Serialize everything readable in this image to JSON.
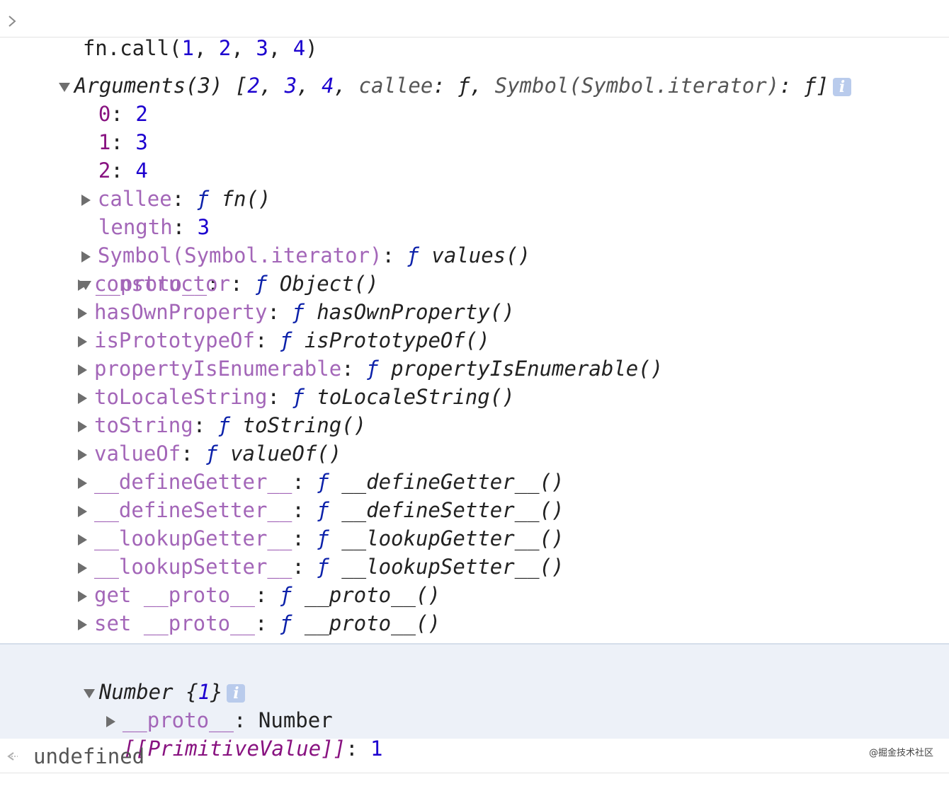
{
  "command": {
    "text": "fn.call(",
    "args": [
      "1",
      "2",
      "3",
      "4"
    ],
    "close": ")"
  },
  "args_summary": {
    "label": "Arguments(3)",
    "open": " [",
    "v1": "2",
    "v2": "3",
    "v3": "4",
    "callee_key": "callee",
    "colon_f": ": ƒ, ",
    "symbol_key": "Symbol(Symbol.iterator)",
    "end": ": ƒ]"
  },
  "indices": [
    {
      "key": "0",
      "value": "2"
    },
    {
      "key": "1",
      "value": "3"
    },
    {
      "key": "2",
      "value": "4"
    }
  ],
  "callee": {
    "key": "callee",
    "f": "ƒ",
    "value": "fn()"
  },
  "length": {
    "key": "length",
    "value": "3"
  },
  "iterator": {
    "key": "Symbol(Symbol.iterator)",
    "f": "ƒ",
    "value": "values()"
  },
  "proto": {
    "key": "__proto__"
  },
  "proto_items": [
    {
      "key": "constructor",
      "value": "Object()"
    },
    {
      "key": "hasOwnProperty",
      "value": "hasOwnProperty()"
    },
    {
      "key": "isPrototypeOf",
      "value": "isPrototypeOf()"
    },
    {
      "key": "propertyIsEnumerable",
      "value": "propertyIsEnumerable()"
    },
    {
      "key": "toLocaleString",
      "value": "toLocaleString()"
    },
    {
      "key": "toString",
      "value": "toString()"
    },
    {
      "key": "valueOf",
      "value": "valueOf()"
    },
    {
      "key": "__defineGetter__",
      "value": "__defineGetter__()"
    },
    {
      "key": "__defineSetter__",
      "value": "__defineSetter__()"
    },
    {
      "key": "__lookupGetter__",
      "value": "__lookupGetter__()"
    },
    {
      "key": "__lookupSetter__",
      "value": "__lookupSetter__()"
    },
    {
      "key": "get __proto__",
      "value": "__proto__()"
    },
    {
      "key": "set __proto__",
      "value": "__proto__()"
    }
  ],
  "f_symbol": "ƒ",
  "number_obj": {
    "label": "Number ",
    "brace_open": "{",
    "value": "1",
    "brace_close": "}",
    "proto_key": "__proto__",
    "proto_value": "Number",
    "primitive_key": "[[PrimitiveValue]]",
    "primitive_value": "1"
  },
  "result": {
    "text": "undefined"
  },
  "watermark": "@掘金技术社区",
  "colors": {
    "key": "#881280",
    "dim_key": "#a366b8",
    "number": "#1c00cf",
    "function": "#0d22aa",
    "info_icon": "#b9cbec"
  }
}
